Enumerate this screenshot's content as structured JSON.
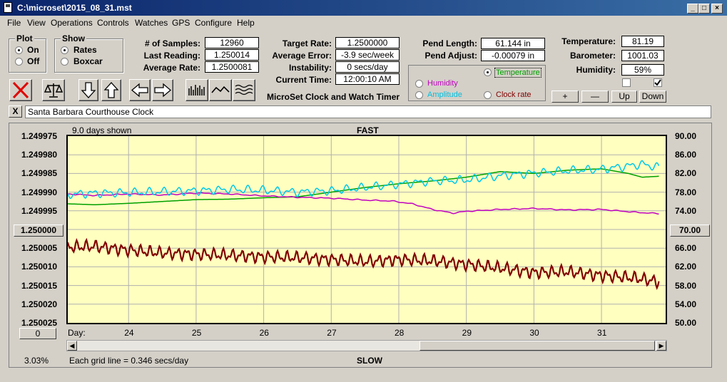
{
  "window": {
    "title": "C:\\microset\\2015_08_31.mst"
  },
  "menu": [
    "File",
    "View",
    "Operations",
    "Controls",
    "Watches",
    "GPS",
    "Configure",
    "Help"
  ],
  "plot_group": {
    "title": "Plot",
    "options": [
      "On",
      "Off"
    ],
    "selected": "On"
  },
  "show_group": {
    "title": "Show",
    "options": [
      "Rates",
      "Boxcar"
    ],
    "selected": "Rates"
  },
  "stats": {
    "samples_label": "# of Samples:",
    "samples": "12960",
    "last_label": "Last Reading:",
    "last": "1.250014",
    "avg_rate_label": "Average Rate:",
    "avg_rate": "1.2500081",
    "target_label": "Target Rate:",
    "target": "1.2500000",
    "avg_err_label": "Average Error:",
    "avg_err": "-3.9 sec/week",
    "instab_label": "Instability:",
    "instab": "0 secs/day",
    "time_label": "Current Time:",
    "time": "12:00:10 AM",
    "pend_len_label": "Pend Length:",
    "pend_len": "61.144 in",
    "pend_adj_label": "Pend Adjust:",
    "pend_adj": "-0.00079 in",
    "temp_label": "Temperature:",
    "temp": "81.19",
    "baro_label": "Barometer:",
    "baro": "1001.03",
    "hum_label": "Humidity:",
    "hum": "59%"
  },
  "app_caption": "MicroSet Clock and Watch Timer",
  "sensor_options": {
    "temperature": "Temperature",
    "humidity": "Humidity",
    "amplitude": "Amplitude",
    "clock_rate": "Clock rate",
    "selected": "Temperature",
    "colors": {
      "temperature": "#00a000",
      "humidity": "#c000c0",
      "amplitude": "#00c0e0",
      "clock_rate": "#800000"
    }
  },
  "adjust_buttons": {
    "plus": "+",
    "minus": "—",
    "up": "Up",
    "down": "Down"
  },
  "checkboxes": [
    {
      "checked": false
    },
    {
      "checked": true
    }
  ],
  "clock_name": "Santa Barbara Courthouse Clock",
  "close_x": "X",
  "chart_labels": {
    "days_shown": "9.0 days shown",
    "fast": "FAST",
    "slow": "SLOW",
    "left_center": "1.250000",
    "right_center": "70.00",
    "bottom_left_btn": "0",
    "day_label": "Day:",
    "pct": "3.03%",
    "grid_note": "Each grid line = 0.346 secs/day"
  },
  "chart_data": {
    "type": "line",
    "xlabel": "Day:",
    "x_ticks": [
      "24",
      "25",
      "26",
      "27",
      "28",
      "29",
      "30",
      "31"
    ],
    "x_range": [
      23.1,
      31.95
    ],
    "y_left_ticks": [
      "1.249975",
      "1.249980",
      "1.249985",
      "1.249990",
      "1.249995",
      "1.250000",
      "1.250005",
      "1.250010",
      "1.250015",
      "1.250020",
      "1.250025"
    ],
    "y_left_range_top_to_bottom": [
      1.249975,
      1.250025
    ],
    "y_right_ticks": [
      "90.00",
      "86.00",
      "82.00",
      "78.00",
      "74.00",
      "70.00",
      "66.00",
      "62.00",
      "58.00",
      "54.00",
      "50.00"
    ],
    "y_right_range_top_to_bottom": [
      90,
      50
    ],
    "grid": true,
    "series": [
      {
        "key": "temperature",
        "axis": "right",
        "color": "#00a000",
        "points": [
          [
            23.1,
            75.5
          ],
          [
            23.5,
            75.3
          ],
          [
            24.0,
            75.6
          ],
          [
            24.5,
            76.0
          ],
          [
            25.0,
            76.4
          ],
          [
            25.5,
            76.5
          ],
          [
            26.0,
            76.8
          ],
          [
            26.5,
            77.0
          ],
          [
            27.0,
            78.0
          ],
          [
            27.5,
            79.0
          ],
          [
            28.0,
            79.8
          ],
          [
            28.5,
            80.4
          ],
          [
            29.0,
            81.2
          ],
          [
            29.5,
            82.4
          ],
          [
            30.0,
            82.0
          ],
          [
            30.5,
            82.7
          ],
          [
            31.0,
            83.0
          ],
          [
            31.4,
            82.0
          ],
          [
            31.6,
            81.2
          ],
          [
            31.85,
            81.4
          ]
        ]
      },
      {
        "key": "humidity",
        "axis": "right",
        "color": "#c000c0",
        "points": [
          [
            23.1,
            77.6
          ],
          [
            23.5,
            77.3
          ],
          [
            24.0,
            77.6
          ],
          [
            24.5,
            77.4
          ],
          [
            25.0,
            77.8
          ],
          [
            25.5,
            77.6
          ],
          [
            26.0,
            77.2
          ],
          [
            26.5,
            76.9
          ],
          [
            27.0,
            76.7
          ],
          [
            27.5,
            76.3
          ],
          [
            27.9,
            76.1
          ],
          [
            28.2,
            75.5
          ],
          [
            28.5,
            74.3
          ],
          [
            28.8,
            73.5
          ],
          [
            29.0,
            73.9
          ],
          [
            29.5,
            74.3
          ],
          [
            30.0,
            74.5
          ],
          [
            30.5,
            74.2
          ],
          [
            31.0,
            74.3
          ],
          [
            31.5,
            73.7
          ],
          [
            31.85,
            73.4
          ]
        ]
      },
      {
        "key": "amplitude",
        "axis": "right",
        "color": "#00c8e8",
        "points": [
          [
            23.1,
            77.5
          ],
          [
            23.5,
            77.8
          ],
          [
            24.0,
            77.9
          ],
          [
            24.5,
            78.1
          ],
          [
            25.0,
            78.3
          ],
          [
            25.5,
            78.6
          ],
          [
            26.0,
            78.4
          ],
          [
            26.5,
            78.0
          ],
          [
            27.0,
            78.3
          ],
          [
            27.5,
            79.0
          ],
          [
            28.0,
            79.7
          ],
          [
            28.5,
            80.4
          ],
          [
            29.0,
            80.6
          ],
          [
            29.5,
            81.5
          ],
          [
            30.0,
            82.1
          ],
          [
            30.5,
            82.6
          ],
          [
            31.0,
            82.9
          ],
          [
            31.4,
            83.6
          ],
          [
            31.6,
            84.0
          ],
          [
            31.85,
            83.3
          ]
        ]
      },
      {
        "key": "clock_rate",
        "axis": "left",
        "color": "#800000",
        "points": [
          [
            23.1,
            1.2500047
          ],
          [
            23.5,
            1.2500045
          ],
          [
            24.0,
            1.2500055
          ],
          [
            24.5,
            1.2500063
          ],
          [
            25.0,
            1.2500066
          ],
          [
            25.5,
            1.2500069
          ],
          [
            26.0,
            1.2500073
          ],
          [
            26.5,
            1.2500075
          ],
          [
            27.0,
            1.250008
          ],
          [
            27.5,
            1.2500086
          ],
          [
            28.0,
            1.250008
          ],
          [
            28.5,
            1.2500084
          ],
          [
            29.0,
            1.2500093
          ],
          [
            29.5,
            1.2500103
          ],
          [
            30.0,
            1.2500115
          ],
          [
            30.5,
            1.2500113
          ],
          [
            31.0,
            1.2500123
          ],
          [
            31.5,
            1.250013
          ],
          [
            31.85,
            1.250014
          ]
        ]
      }
    ]
  }
}
